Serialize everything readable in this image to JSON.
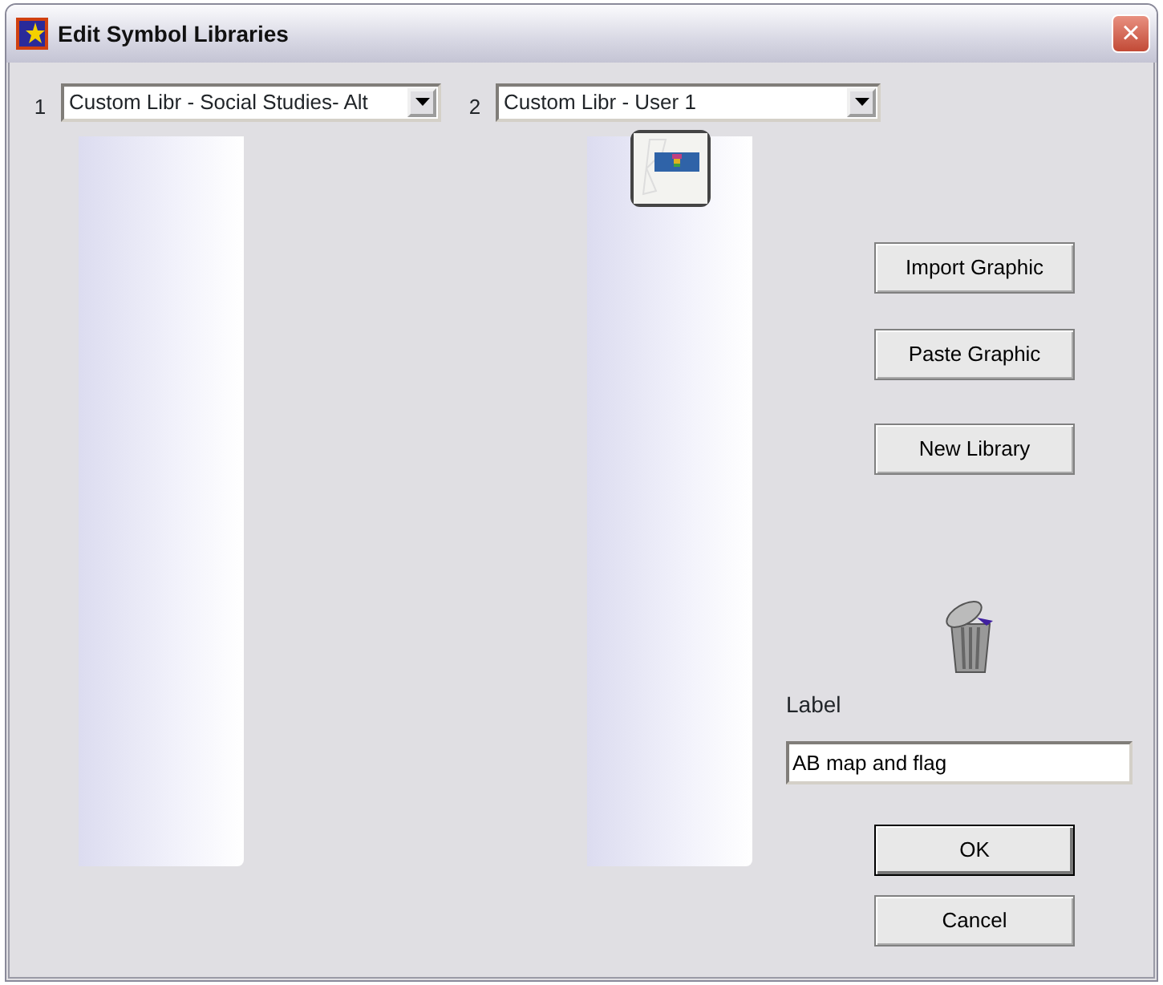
{
  "window": {
    "title": "Edit Symbol Libraries",
    "close": "×"
  },
  "libraries": [
    {
      "number": "1",
      "selection": "Custom Libr - Social Studies- Alt"
    },
    {
      "number": "2",
      "selection": "Custom Libr - User 1",
      "items": [
        {
          "kind": "picture",
          "selected": true
        }
      ]
    }
  ],
  "actions": [
    "Import Graphic",
    "Paste Graphic",
    "New Library"
  ],
  "label": {
    "text": "Label",
    "value": "AB map and flag"
  },
  "buttons": [
    "OK",
    "Cancel"
  ]
}
